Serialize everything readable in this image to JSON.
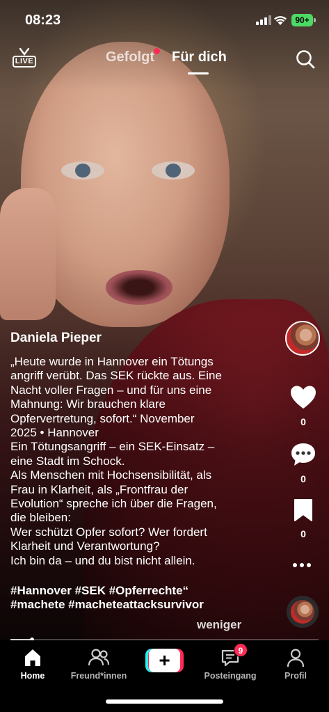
{
  "status_bar": {
    "time": "08:23",
    "battery": "90+",
    "battery_color": "#4cd964"
  },
  "top_nav": {
    "live_label": "LIVE",
    "tabs": [
      {
        "label": "Gefolgt",
        "has_dot": true
      },
      {
        "label": "Für dich",
        "active": true
      }
    ],
    "search_icon": "search-icon",
    "accent": "#fe2c55"
  },
  "post": {
    "author": "Daniela Pieper",
    "caption": "„Heute wurde in Hannover ein Tötungs\nangriff verübt. Das SEK rückte aus. Eine\nNacht voller Fragen – und für uns eine\nMahnung: Wir brauchen klare\nOpfervertretung, sofort.“  November\n2025 • Hannover\nEin Tötungsangriff – ein SEK-Einsatz –\neine Stadt im Schock.\nAls Menschen mit Hochsensibilität, als\nFrau in Klarheit, als „Frontfrau der\nEvolution“ spreche ich über die Fragen,\ndie bleiben:\nWer schützt Opfer sofort? Wer fordert\nKlarheit und Verantwortung?\nIch bin da – und du bist nicht allein.",
    "hashtags": "#Hannover #SEK #Opferrechte“\n#machete #macheteattacksurvivor",
    "less_label": "weniger",
    "progress": 0.07
  },
  "rail": {
    "like_count": "0",
    "comment_count": "0",
    "save_count": "0"
  },
  "bottom_nav": {
    "items": [
      {
        "label": "Home",
        "icon": "home-icon",
        "active": true
      },
      {
        "label": "Freund*innen",
        "icon": "friends-icon"
      },
      {
        "label": "Posteingang",
        "icon": "inbox-icon",
        "badge": "9"
      },
      {
        "label": "Profil",
        "icon": "profile-icon"
      }
    ],
    "create_label": "+"
  }
}
